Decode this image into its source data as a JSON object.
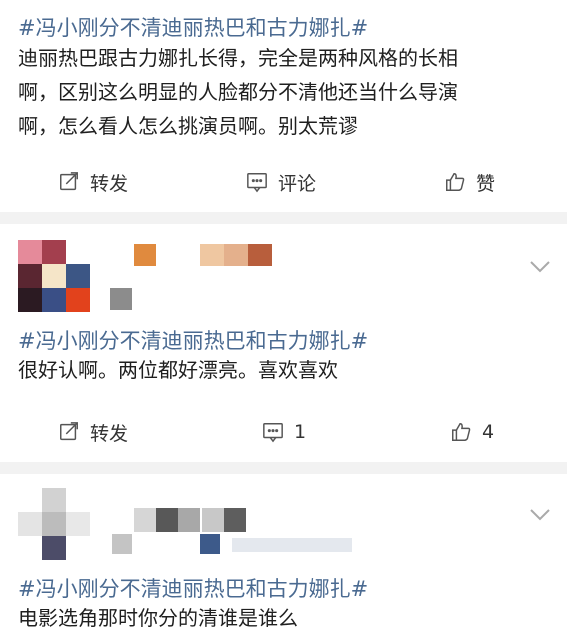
{
  "posts": [
    {
      "hashtag": "#冯小刚分不清迪丽热巴和古力娜扎#",
      "lines": [
        "迪丽热巴跟古力娜扎长得，完全是两种风格的长相",
        "啊，区别这么明显的人脸都分不清他还当什么导演",
        "啊，怎么看人怎么挑演员啊。别太荒谬"
      ],
      "actions": {
        "repost": "转发",
        "comment": "评论",
        "like": "赞"
      }
    },
    {
      "hashtag": "#冯小刚分不清迪丽热巴和古力娜扎#",
      "lines": [
        "很好认啊。两位都好漂亮。喜欢喜欢"
      ],
      "actions": {
        "repost": "转发",
        "comment": "1",
        "like": "4"
      }
    },
    {
      "hashtag": "#冯小刚分不清迪丽热巴和古力娜扎#",
      "lines": [
        "电影选角那时你分的清谁是谁么"
      ]
    }
  ],
  "colors": {
    "hashtag": "#4a6a91",
    "separator": "#f2f2f2",
    "icon": "#555555"
  }
}
